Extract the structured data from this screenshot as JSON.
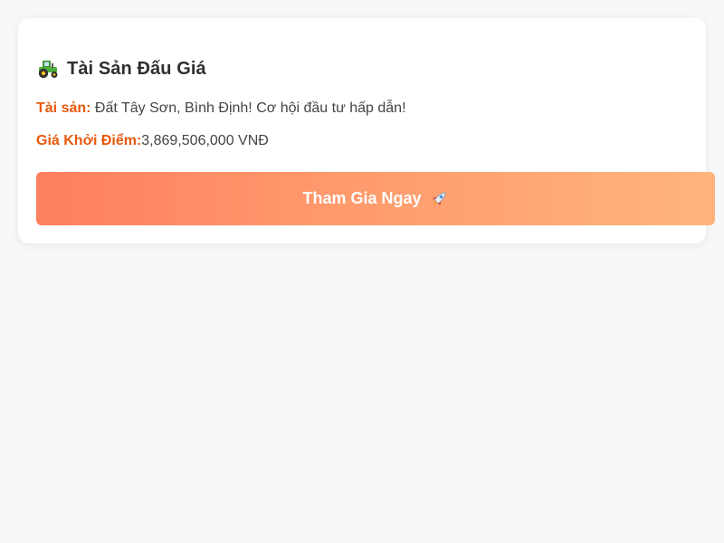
{
  "card": {
    "title": "Tài Sản Đấu Giá",
    "title_icon": "tractor-icon",
    "asset_label": "Tài sản:",
    "asset_value": " Đất Tây Sơn, Bình Định! Cơ hội đầu tư hấp dẫn!",
    "price_label": "Giá Khởi Điểm:",
    "price_value": "3,869,506,000 VNĐ",
    "button_label": "Tham Gia Ngay",
    "button_icon": "rocket-icon"
  },
  "colors": {
    "page_background": "#f7f8fa",
    "card_background": "#ffffff",
    "label_accent": "#e8590c",
    "button_gradient_start": "#ff7f5e",
    "button_gradient_end": "#ffb47c",
    "button_text": "#ffffff"
  }
}
